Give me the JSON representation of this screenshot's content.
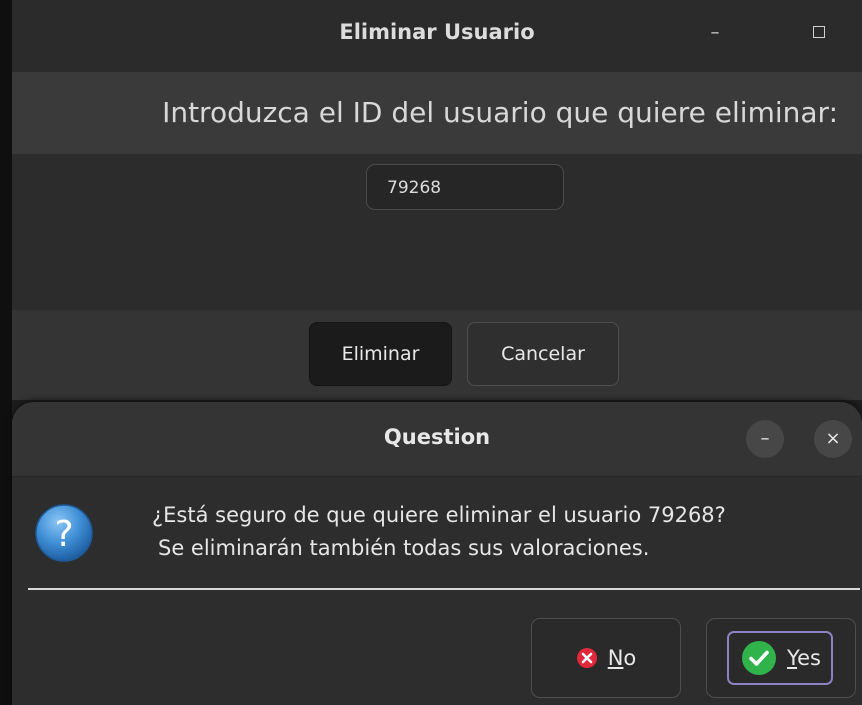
{
  "main_window": {
    "title": "Eliminar Usuario",
    "minimize_glyph": "–",
    "prompt": "Introduzca el ID del usuario que quiere eliminar:",
    "id_value": "79268",
    "buttons": {
      "eliminar": "Eliminar",
      "cancelar": "Cancelar"
    }
  },
  "dialog": {
    "title": "Question",
    "minimize_glyph": "–",
    "close_glyph": "×",
    "icon": "question-icon",
    "message_line1": "¿Está seguro de que quiere eliminar el usuario 79268?",
    "message_line2": "Se eliminarán también todas sus valoraciones.",
    "buttons": {
      "no_mnemonic": "N",
      "no_rest": "o",
      "yes_mnemonic": "Y",
      "yes_rest": "es"
    }
  },
  "colors": {
    "question_icon": "#3f8fd6",
    "no_icon": "#e0283a",
    "yes_icon": "#2fb34a",
    "focus_ring": "#8b82c4"
  }
}
